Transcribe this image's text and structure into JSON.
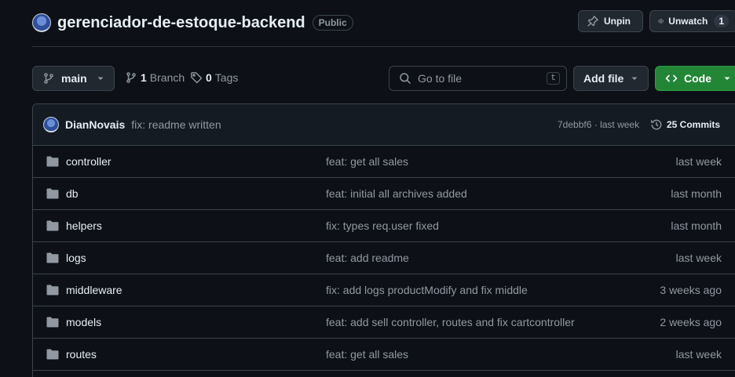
{
  "repo": {
    "name": "gerenciador-de-estoque-backend",
    "visibility": "Public"
  },
  "header_actions": {
    "unpin_label": "Unpin",
    "unwatch_label": "Unwatch",
    "watch_count": "1"
  },
  "toolbar": {
    "branch": "main",
    "branch_count": "1",
    "branch_label": "Branch",
    "tag_count": "0",
    "tag_label": "Tags",
    "search_placeholder": "Go to file",
    "search_shortcut": "t",
    "add_file_label": "Add file",
    "code_label": "Code"
  },
  "latest_commit": {
    "author": "DianNovais",
    "message": "fix: readme written",
    "hash": "7debbf6",
    "time": "last week",
    "commits_label": "25 Commits"
  },
  "files": [
    {
      "name": "controller",
      "message": "feat: get all sales",
      "date": "last week"
    },
    {
      "name": "db",
      "message": "feat: initial all archives added",
      "date": "last month"
    },
    {
      "name": "helpers",
      "message": "fix: types req.user fixed",
      "date": "last month"
    },
    {
      "name": "logs",
      "message": "feat: add readme",
      "date": "last week"
    },
    {
      "name": "middleware",
      "message": "fix: add logs productModify and fix middle",
      "date": "3 weeks ago"
    },
    {
      "name": "models",
      "message": "feat: add sell controller, routes and fix cartcontroller",
      "date": "2 weeks ago"
    },
    {
      "name": "routes",
      "message": "feat: get all sales",
      "date": "last week"
    }
  ],
  "colors": {
    "background": "#0d1117",
    "border": "#3d444d",
    "muted_text": "#9198a1",
    "code_button": "#238636"
  }
}
